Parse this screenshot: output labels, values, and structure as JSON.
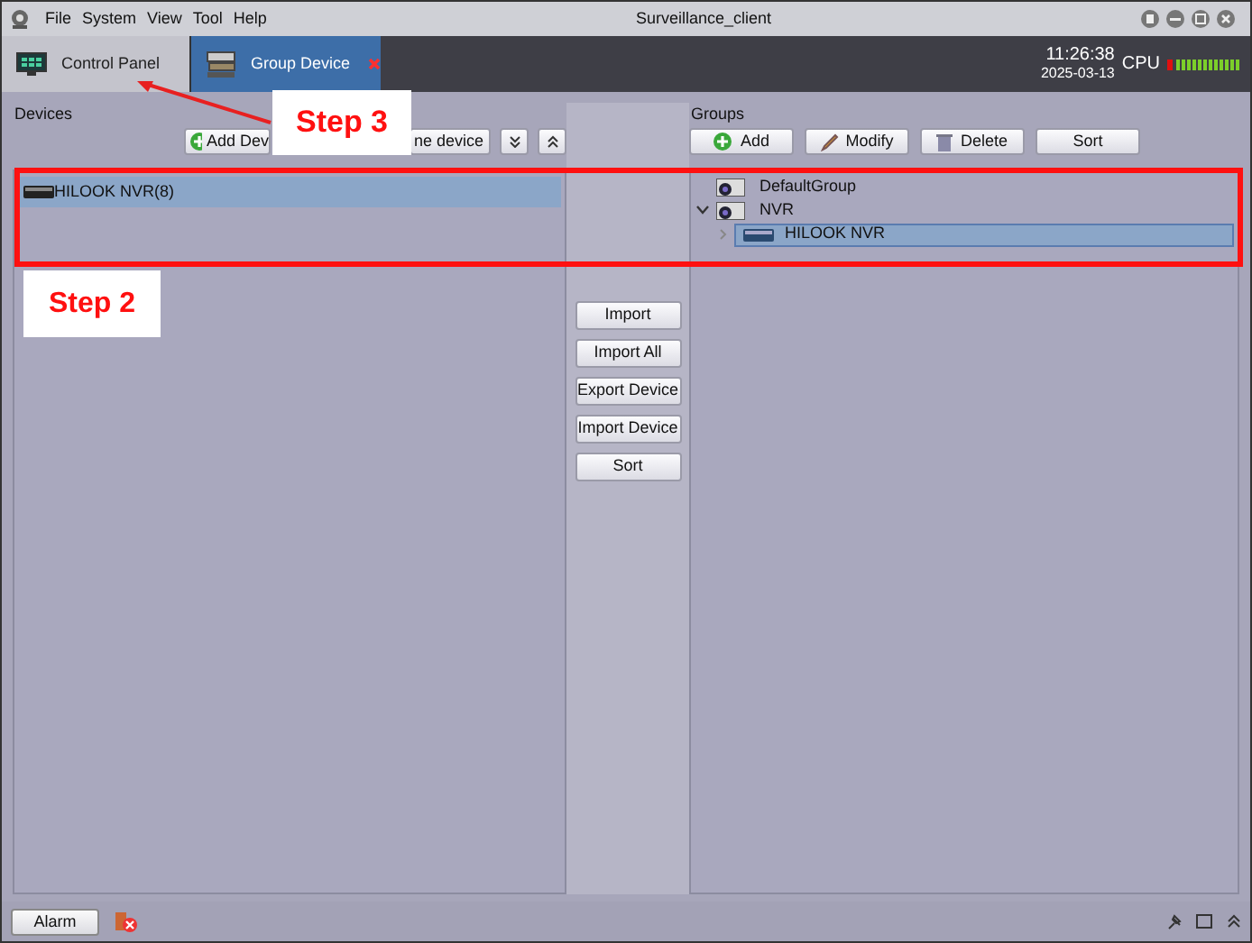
{
  "menu": [
    "File",
    "System",
    "View",
    "Tool",
    "Help"
  ],
  "window": {
    "title": "Surveillance_client"
  },
  "tabs": [
    {
      "label": "Control Panel",
      "selected": false,
      "closable": false
    },
    {
      "label": "Group Device",
      "selected": true,
      "closable": true
    }
  ],
  "clock": {
    "time": "11:26:38",
    "date": "2025-03-13",
    "cpu_label": "CPU"
  },
  "devices": {
    "title": "Devices",
    "buttons": [
      "Add Dev",
      "ne device"
    ],
    "items": [
      {
        "label": "HILOOK NVR(8)",
        "selected": true
      }
    ]
  },
  "middle_buttons": [
    "Import",
    "Import All",
    "Export Device",
    "Import Device",
    "Sort"
  ],
  "groups": {
    "title": "Groups",
    "buttons": [
      {
        "label": "Add",
        "kind": "add"
      },
      {
        "label": "Modify",
        "kind": "modify"
      },
      {
        "label": "Delete",
        "kind": "delete"
      },
      {
        "label": "Sort",
        "kind": "plain"
      }
    ],
    "tree": [
      {
        "label": "DefaultGroup"
      },
      {
        "label": "NVR",
        "expanded": true,
        "children": [
          {
            "label": "HILOOK NVR",
            "selected": true
          }
        ]
      }
    ]
  },
  "status_bar": {
    "alarm_button": "Alarm"
  },
  "annotations": [
    {
      "label": "Step 3"
    },
    {
      "label": "Step 2"
    }
  ]
}
